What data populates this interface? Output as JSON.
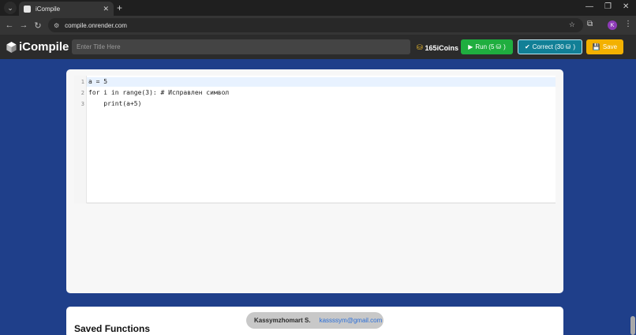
{
  "browser": {
    "tab_title": "iCompile",
    "url": "compile.onrender.com",
    "profile_initial": "K"
  },
  "navbar": {
    "logo_text": "iCompile",
    "title_placeholder": "Enter Title Here",
    "coins": "165iCoins",
    "run_label": "Run (5",
    "run_suffix": ")",
    "correct_label": "Correct (30",
    "correct_suffix": ")",
    "save_label": "Save"
  },
  "editor": {
    "line_numbers": [
      "1",
      "2",
      "3"
    ],
    "lines": [
      "a = 5",
      "for i in range(3): # Исправлен символ",
      "    print(a+5)"
    ]
  },
  "saved": {
    "title": "Saved Functions"
  },
  "footer": {
    "name": "Kassymzhomart S.",
    "email": "kassssym@gmail.com"
  },
  "colors": {
    "page_bg": "#1f3f8a",
    "run": "#1fae3f",
    "correct": "#117f96",
    "save": "#f3b100"
  }
}
